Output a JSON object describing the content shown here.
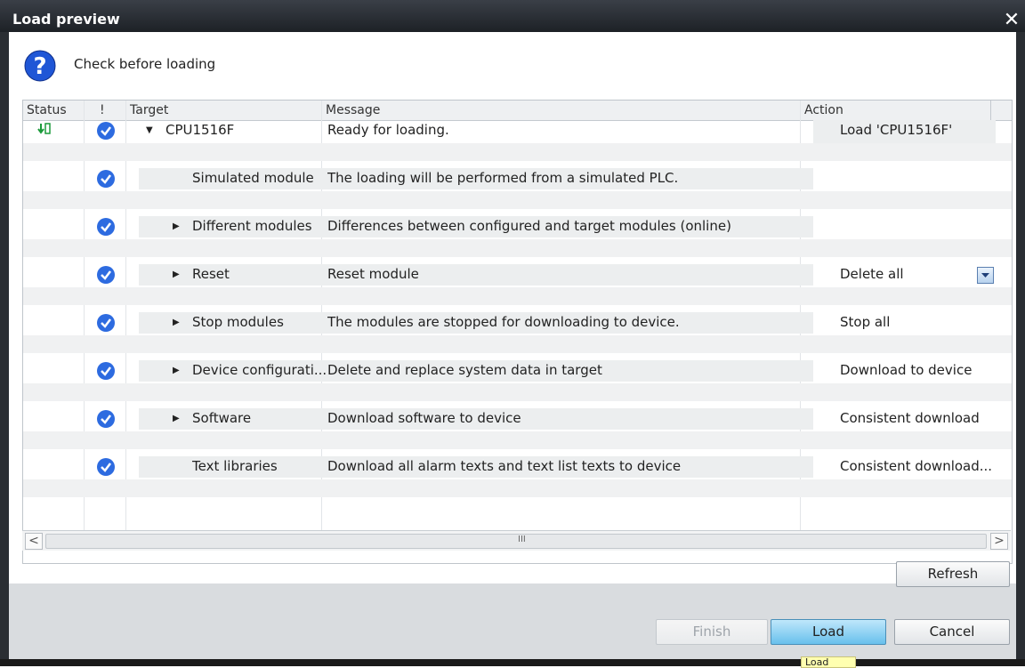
{
  "window": {
    "title": "Load preview",
    "close_glyph": "✕"
  },
  "dialog": {
    "check_label": "Check before loading"
  },
  "table": {
    "headers": {
      "status": "Status",
      "flag": "!",
      "target": "Target",
      "message": "Message",
      "action": "Action"
    },
    "rows": [
      {
        "target": "CPU1516F",
        "message": "Ready for loading.",
        "action": "Load 'CPU1516F'",
        "expand": "expanded",
        "status_icon": "download-status-icon",
        "check": "check-icon"
      },
      {
        "target": "Simulated module",
        "message": "The loading will be performed from a simulated PLC.",
        "action": "",
        "expand": "none",
        "check": "check-icon"
      },
      {
        "target": "Different modules",
        "message": "Differences between configured and target modules (online)",
        "action": "",
        "expand": "collapsed",
        "check": "check-icon"
      },
      {
        "target": "Reset",
        "message": "Reset module",
        "action": "Delete all",
        "expand": "collapsed",
        "check": "check-icon",
        "dropdown": true
      },
      {
        "target": "Stop modules",
        "message": "The modules are stopped for downloading to device.",
        "action": "Stop all",
        "expand": "collapsed",
        "check": "check-icon"
      },
      {
        "target": "Device configurati...",
        "message": "Delete and replace system data in target",
        "action": "Download to device",
        "expand": "collapsed",
        "check": "check-icon"
      },
      {
        "target": "Software",
        "message": "Download software to device",
        "action": "Consistent download",
        "expand": "collapsed",
        "check": "check-icon"
      },
      {
        "target": "Text libraries",
        "message": "Download all alarm texts and text list texts to device",
        "action": "Consistent download...",
        "expand": "none",
        "check": "check-icon"
      }
    ]
  },
  "scrollbar": {
    "left": "<",
    "right": ">",
    "grip": "III"
  },
  "buttons": {
    "refresh": "Refresh",
    "finish": "Finish",
    "load": "Load",
    "cancel": "Cancel"
  },
  "tooltip": {
    "text": "Load"
  },
  "colors": {
    "accent": "#2d6be0",
    "load_button": "#68c0ec",
    "titlebar": "#1d2126"
  }
}
